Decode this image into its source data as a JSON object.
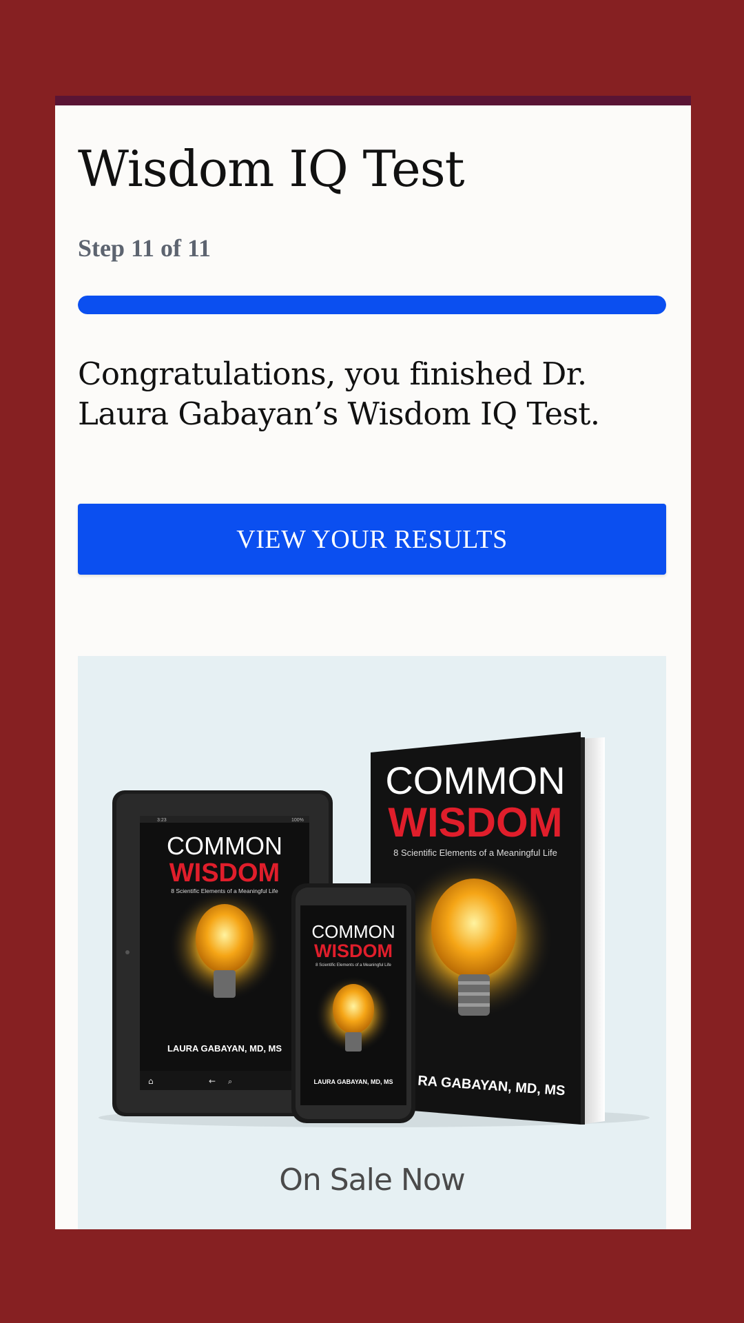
{
  "quiz": {
    "title": "Wisdom IQ Test",
    "step_label": "Step 11 of 11",
    "progress": 1.0,
    "message": "Congratulations, you finished Dr. Laura Gabayan’s Wisdom IQ Test.",
    "cta_label": "VIEW YOUR RESULTS"
  },
  "promo": {
    "book_title_line1": "COMMON",
    "book_title_line2": "WISDOM",
    "book_subtitle": "8 Scientific Elements of a Meaningful Life",
    "book_author": "LAURA GABAYAN, MD, MS",
    "book_author_cropped": "RA GABAYAN, MD, MS",
    "tablet_status_time": "3:23",
    "tablet_status_battery": "100%",
    "caption": "On Sale Now"
  },
  "colors": {
    "background": "#862022",
    "card": "#fcfbf9",
    "card_accent": "#5a1434",
    "accent_blue": "#0b4ff0",
    "promo_bg": "#e6f0f3",
    "book_red": "#e01e2b"
  }
}
